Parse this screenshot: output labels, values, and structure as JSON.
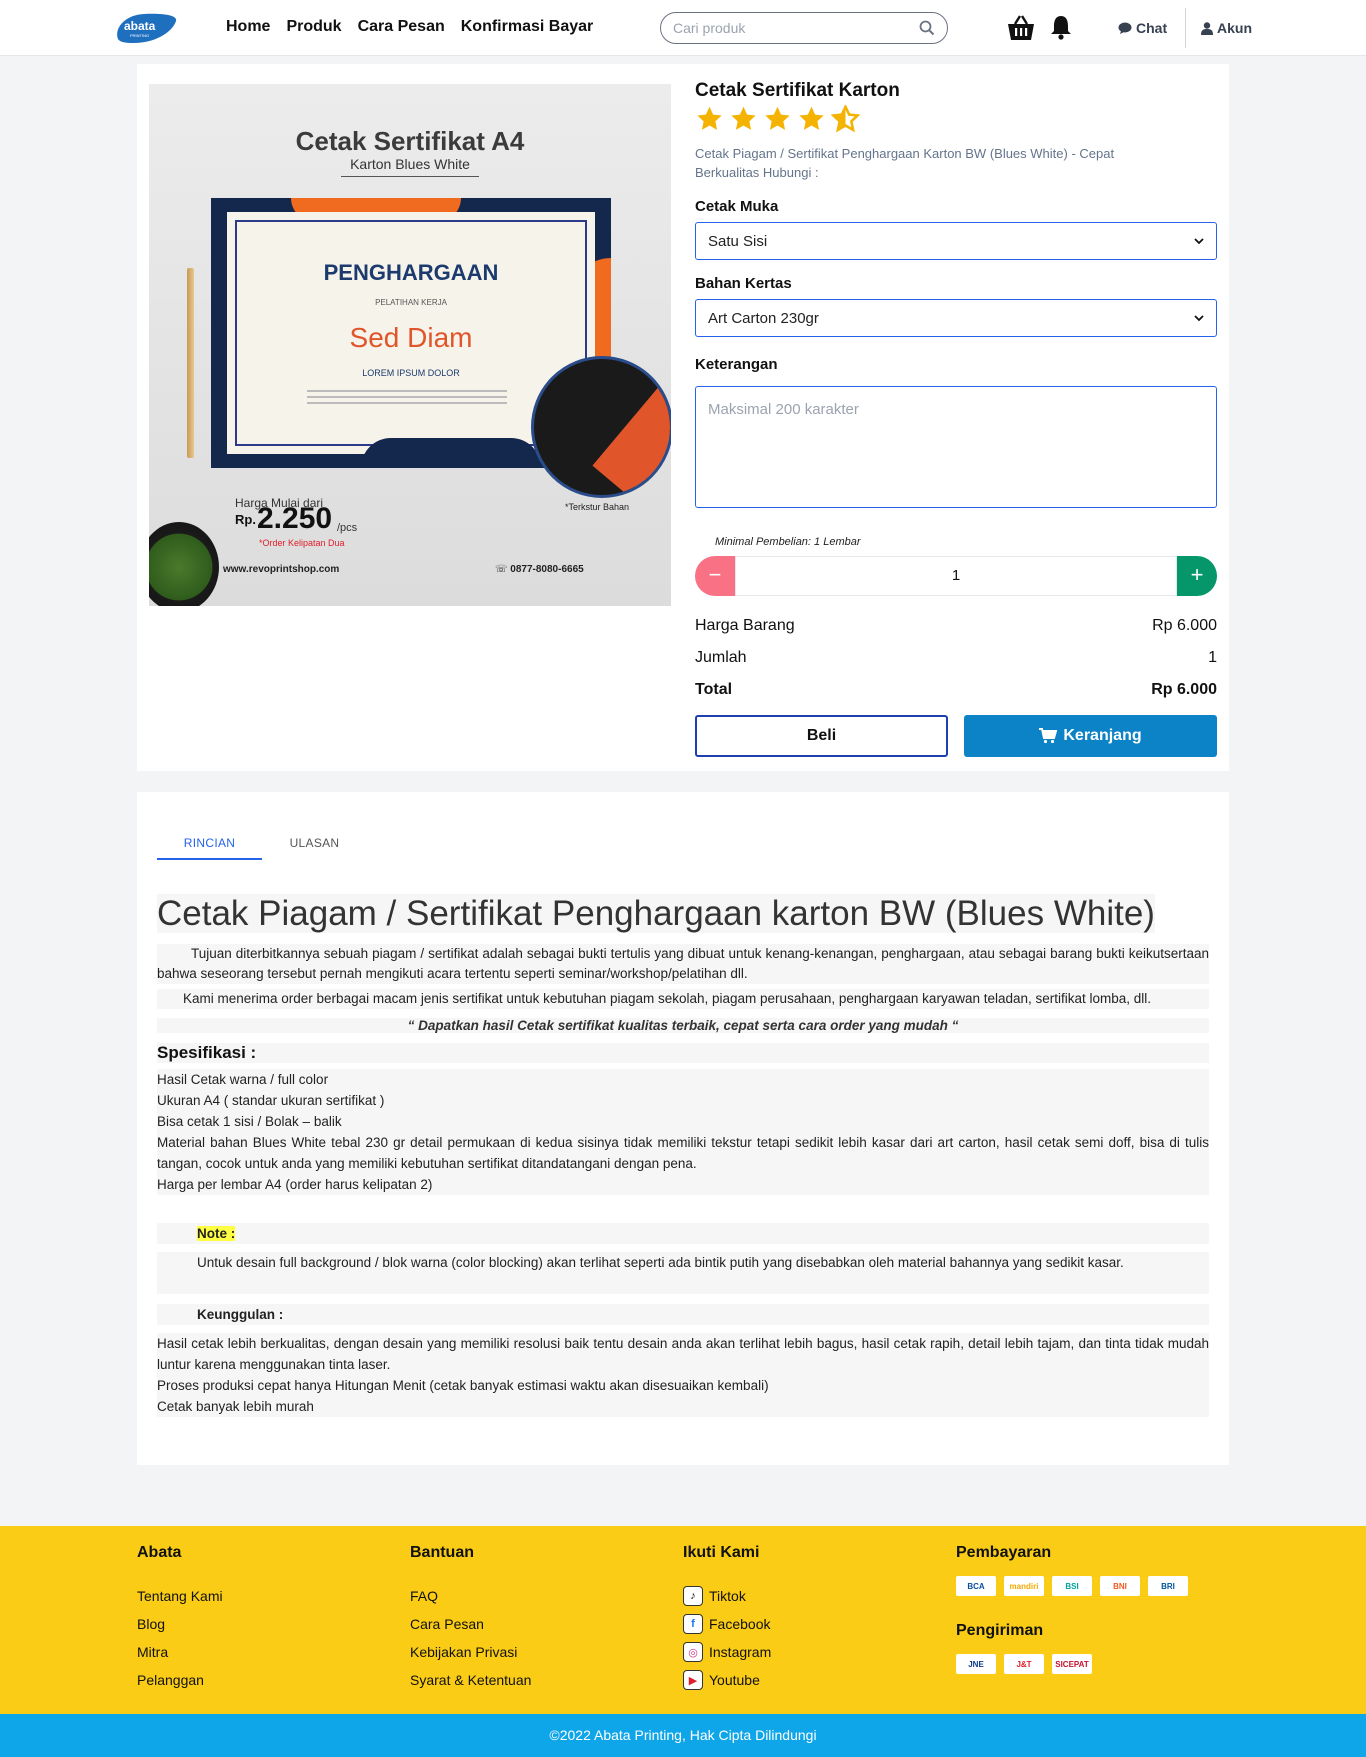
{
  "header": {
    "logo_text": "abata",
    "logo_sub": "PRINTING",
    "nav": [
      "Home",
      "Produk",
      "Cara Pesan",
      "Konfirmasi Bayar"
    ],
    "search_placeholder": "Cari produk",
    "chat_label": "Chat",
    "account_label": "Akun"
  },
  "product": {
    "title": "Cetak Sertifikat Karton",
    "rating": 4.5,
    "description": "Cetak Piagam / Sertifikat Penghargaan Karton BW (Blues White) - Cepat Berkualitas Hubungi :",
    "image": {
      "title": "Cetak Sertifikat A4",
      "subtitle": "Karton Blues White",
      "cert_heading": "PENGHARGAAN",
      "cert_small": "PELATIHAN KERJA",
      "cert_name": "Sed Diam",
      "cert_lorem": "LOREM IPSUM DOLOR",
      "price_label": "Harga Mulai dari",
      "price_rp": "Rp.",
      "price": "2.250",
      "price_unit": "/pcs",
      "price_note": "*Order Kelipatan Dua",
      "texture_label": "*Terkstur Bahan",
      "website": "www.revoprintshop.com",
      "phone": "0877-8080-6665"
    },
    "cetak_muka_label": "Cetak Muka",
    "cetak_muka_value": "Satu Sisi",
    "bahan_label": "Bahan Kertas",
    "bahan_value": "Art Carton 230gr",
    "keterangan_label": "Keterangan",
    "keterangan_placeholder": "Maksimal 200 karakter",
    "min_note": "Minimal Pembelian: 1 Lembar",
    "qty": "1",
    "minus_label": "−",
    "plus_label": "+",
    "harga_label": "Harga Barang",
    "harga_value": "Rp 6.000",
    "jumlah_label": "Jumlah",
    "jumlah_value": "1",
    "total_label": "Total",
    "total_value": "Rp 6.000",
    "buy_label": "Beli",
    "cart_label": "Keranjang"
  },
  "tabs": [
    "RINCIAN",
    "ULASAN"
  ],
  "details": {
    "heading": "Cetak Piagam / Sertifikat Penghargaan karton BW (Blues White)",
    "p1": "Tujuan diterbitkannya sebuah piagam / sertifikat adalah sebagai bukti tertulis yang dibuat untuk kenang-kenangan, penghargaan, atau sebagai barang bukti keikutsertaan bahwa seseorang tersebut pernah mengikuti acara tertentu seperti seminar/workshop/pelatihan dll.",
    "p2": "Kami menerima order berbagai macam jenis sertifikat untuk kebutuhan piagam sekolah, piagam perusahaan, penghargaan karyawan teladan,  sertifikat lomba, dll.",
    "quote": "“ Dapatkan hasil Cetak  sertifikat kualitas terbaik, cepat serta cara order yang mudah “",
    "spec_heading": "Spesifikasi :",
    "specs": [
      "Hasil Cetak warna / full color",
      "Ukuran A4 ( standar ukuran sertifikat )",
      "Bisa cetak 1 sisi / Bolak – balik",
      "Material bahan Blues White tebal 230 gr detail permukaan di kedua sisinya tidak memiliki tekstur tetapi sedikit lebih kasar dari art carton,  hasil cetak semi doff, bisa di tulis tangan, cocok untuk anda yang memiliki kebutuhan sertifikat ditandatangani dengan pena.",
      "Harga per lembar A4 (order harus kelipatan 2)"
    ],
    "note_label": "Note :",
    "note_text": "Untuk desain full background / blok warna (color blocking) akan terlihat seperti ada bintik putih yang disebabkan oleh material bahannya yang sedikit kasar.",
    "adv_heading": "Keunggulan :",
    "advantages": [
      "Hasil cetak lebih berkualitas, dengan desain yang memiliki resolusi baik tentu desain anda akan terlihat lebih bagus, hasil cetak rapih, detail lebih tajam, dan tinta tidak mudah luntur karena menggunakan tinta laser.",
      "Proses produksi cepat hanya Hitungan Menit (cetak banyak estimasi waktu akan disesuaikan kembali)",
      "Cetak banyak lebih murah"
    ]
  },
  "footer": {
    "col1": {
      "title": "Abata",
      "links": [
        "Tentang Kami",
        "Blog",
        "Mitra",
        "Pelanggan"
      ]
    },
    "col2": {
      "title": "Bantuan",
      "links": [
        "FAQ",
        "Cara Pesan",
        "Kebijakan Privasi",
        "Syarat & Ketentuan"
      ]
    },
    "col3": {
      "title": "Ikuti Kami",
      "links": [
        "Tiktok",
        "Facebook",
        "Instagram",
        "Youtube"
      ]
    },
    "payment_title": "Pembayaran",
    "payments": [
      "BCA",
      "mandiri",
      "BSI",
      "BNI",
      "BRI"
    ],
    "shipping_title": "Pengiriman",
    "shippings": [
      "JNE",
      "J&T",
      "SICEPAT"
    ],
    "copyright": "©2022 Abata Printing, Hak Cipta Dilindungi"
  },
  "colors": {
    "primary": "#0d83c7",
    "footer_bg": "#facc15",
    "bottom_bg": "#0ea5e9",
    "star": "#f5b301"
  }
}
